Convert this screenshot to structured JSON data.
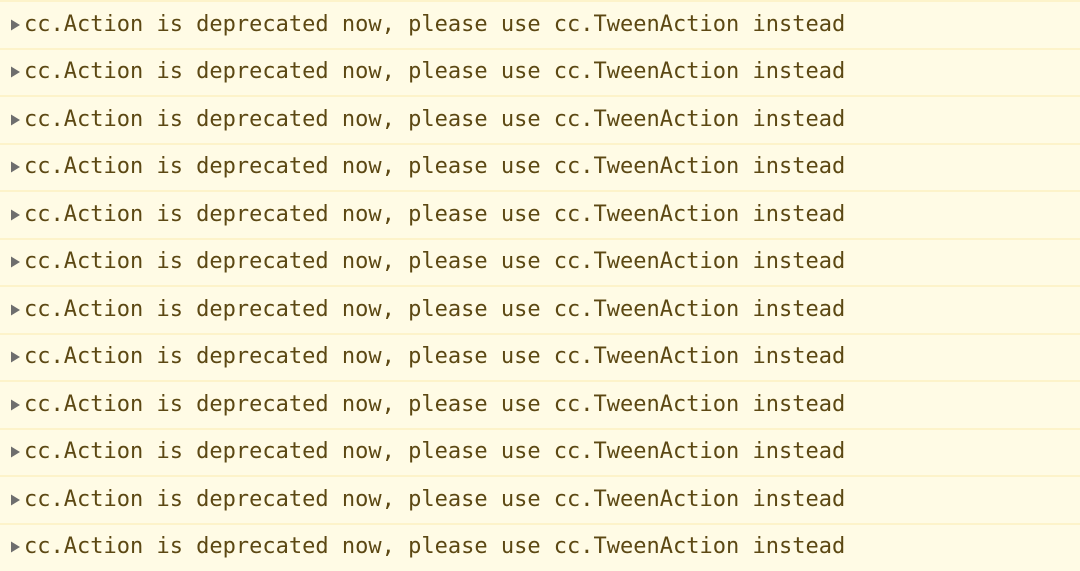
{
  "console": {
    "panel_name": "devtools-console-warnings",
    "colors": {
      "warning_background": "#fffbe5",
      "row_separator": "#fdf3ca",
      "warning_text": "#5c4813",
      "disclosure_triangle": "#6e6e6e"
    },
    "disclosure_icon": "triangle-right-icon",
    "message_text": "cc.Action is deprecated now, please use cc.TweenAction instead",
    "rows": [
      {
        "index": 1,
        "expanded": false,
        "text": "cc.Action is deprecated now, please use cc.TweenAction instead"
      },
      {
        "index": 2,
        "expanded": false,
        "text": "cc.Action is deprecated now, please use cc.TweenAction instead"
      },
      {
        "index": 3,
        "expanded": false,
        "text": "cc.Action is deprecated now, please use cc.TweenAction instead"
      },
      {
        "index": 4,
        "expanded": false,
        "text": "cc.Action is deprecated now, please use cc.TweenAction instead"
      },
      {
        "index": 5,
        "expanded": false,
        "text": "cc.Action is deprecated now, please use cc.TweenAction instead"
      },
      {
        "index": 6,
        "expanded": false,
        "text": "cc.Action is deprecated now, please use cc.TweenAction instead"
      },
      {
        "index": 7,
        "expanded": false,
        "text": "cc.Action is deprecated now, please use cc.TweenAction instead"
      },
      {
        "index": 8,
        "expanded": false,
        "text": "cc.Action is deprecated now, please use cc.TweenAction instead"
      },
      {
        "index": 9,
        "expanded": false,
        "text": "cc.Action is deprecated now, please use cc.TweenAction instead"
      },
      {
        "index": 10,
        "expanded": false,
        "text": "cc.Action is deprecated now, please use cc.TweenAction instead"
      },
      {
        "index": 11,
        "expanded": false,
        "text": "cc.Action is deprecated now, please use cc.TweenAction instead"
      },
      {
        "index": 12,
        "expanded": false,
        "text": "cc.Action is deprecated now, please use cc.TweenAction instead"
      }
    ]
  }
}
